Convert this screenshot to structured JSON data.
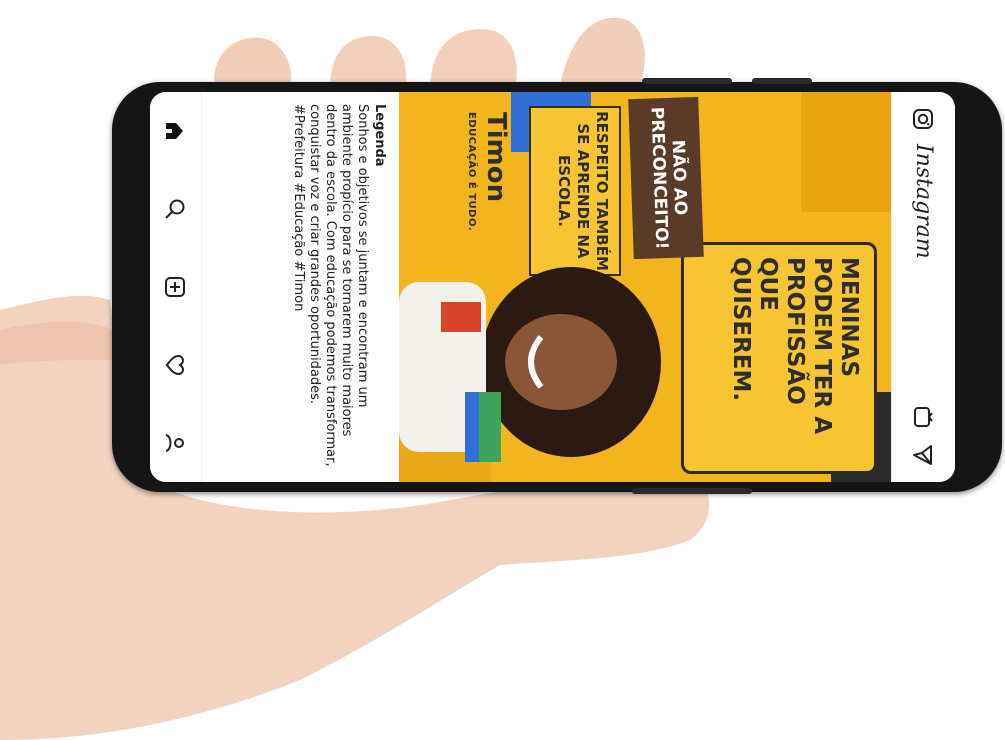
{
  "app": {
    "name": "Instagram"
  },
  "post": {
    "headline": "MENINAS PODEM TER A PROFISSÃO QUE QUISEREM.",
    "tag": "NÃO AO PRECONCEITO!",
    "subhead": "RESPEITO TAMBÉM SE APRENDE NA ESCOLA.",
    "brand": "Timon",
    "brand_tagline": "EDUCAÇÃO É TUDO."
  },
  "caption": {
    "title": "Legenda",
    "text": "Sonhos e objetivos se juntam e encontram um ambiente propício para se tornarem muito maiores dentro da escola. Com educação podemos transformar, conquistar voz e criar grandes oportunidades. #Prefeitura #Educação #Timon"
  },
  "nav": {
    "items": [
      "home-icon",
      "search-icon",
      "add-post-icon",
      "heart-icon",
      "profile-icon"
    ]
  },
  "colors": {
    "poster_yellow": "#f2b51d",
    "tag_brown": "#5a3b28",
    "phone_body": "#151515"
  }
}
